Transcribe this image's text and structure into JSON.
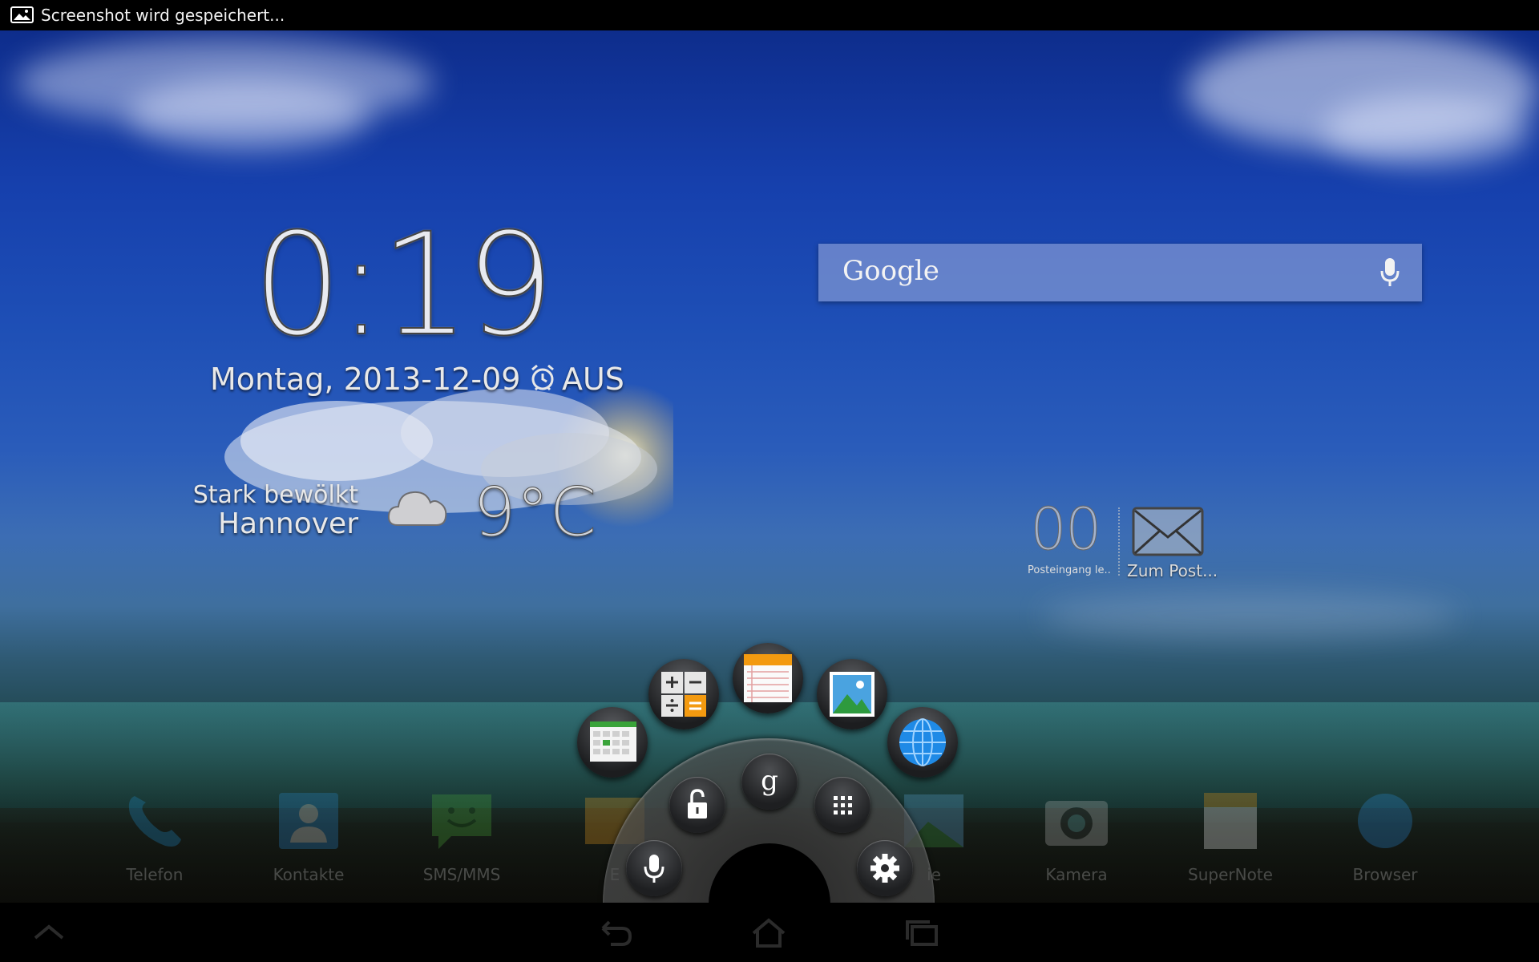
{
  "status_bar": {
    "notification_text": "Screenshot wird gespeichert..."
  },
  "clock": {
    "time": "0:19",
    "date": "Montag, 2013-12-09",
    "alarm_label": "AUS"
  },
  "weather": {
    "condition": "Stark bewölkt",
    "city": "Hannover",
    "temperature": "9°C",
    "icon": "cloud-icon"
  },
  "search": {
    "label": "Google",
    "icon": "mic-icon"
  },
  "mail": {
    "count": "00",
    "inbox_label": "Posteingang le...",
    "goto_label": "Zum Post..."
  },
  "dock": {
    "items": [
      {
        "label": "Telefon",
        "icon": "phone-icon"
      },
      {
        "label": "Kontakte",
        "icon": "contacts-icon"
      },
      {
        "label": "SMS/MMS",
        "icon": "sms-icon"
      },
      {
        "label": "E",
        "icon": "email-icon"
      },
      {
        "label": "ie",
        "icon": "gallery-icon"
      },
      {
        "label": "Kamera",
        "icon": "camera-icon"
      },
      {
        "label": "SuperNote",
        "icon": "supernote-icon"
      },
      {
        "label": "Browser",
        "icon": "browser-icon"
      }
    ]
  },
  "launcher": {
    "favorites": [
      "calendar-icon",
      "calculator-icon",
      "notes-icon",
      "gallery-icon",
      "browser-icon"
    ],
    "buttons": [
      "voice-search-icon",
      "unlock-icon",
      "google-search-icon",
      "all-apps-icon",
      "settings-icon"
    ]
  },
  "colors": {
    "sky_top": "#0e2d8c",
    "search_bar": "#8ca0d7",
    "text": "#e8e8e8"
  }
}
